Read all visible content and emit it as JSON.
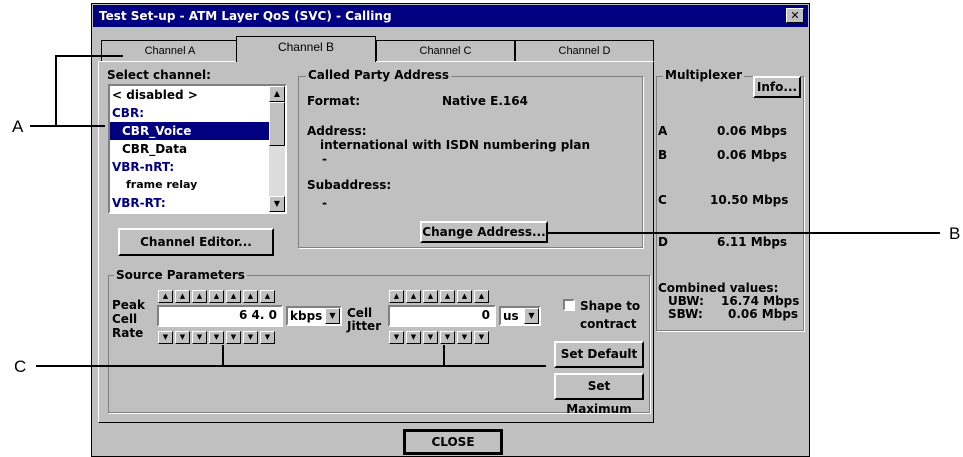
{
  "window": {
    "title": "Test Set-up - ATM Layer QoS (SVC) - Calling",
    "close_glyph": "✕"
  },
  "tabs": [
    {
      "label": "Channel A"
    },
    {
      "label": "Channel B"
    },
    {
      "label": "Channel C"
    },
    {
      "label": "Channel D"
    }
  ],
  "select_channel": {
    "label": "Select channel:",
    "items": [
      {
        "text": "< disabled >",
        "kind": "item"
      },
      {
        "text": "CBR:",
        "kind": "group"
      },
      {
        "text": "CBR_Voice",
        "kind": "selected"
      },
      {
        "text": "CBR_Data",
        "kind": "item"
      },
      {
        "text": "VBR-nRT:",
        "kind": "group"
      },
      {
        "text": "frame relay",
        "kind": "item"
      },
      {
        "text": "VBR-RT:",
        "kind": "group"
      }
    ]
  },
  "channel_editor": {
    "label": "Channel Editor..."
  },
  "called_party": {
    "legend": "Called Party Address",
    "format_label": "Format:",
    "format_value": "Native E.164",
    "address_label": "Address:",
    "address_value": "international with ISDN numbering plan",
    "address_extra": "-",
    "subaddress_label": "Subaddress:",
    "subaddress_value": "-",
    "change_button": "Change Address..."
  },
  "source_params": {
    "legend": "Source Parameters",
    "peak_label_1": "Peak",
    "peak_label_2": "Cell",
    "peak_label_3": "Rate",
    "peak_value": "6 4. 0",
    "peak_unit": "kbps",
    "jitter_label_1": "Cell",
    "jitter_label_2": "Jitter",
    "jitter_value": "0",
    "jitter_unit": "us",
    "shape_label_1": "Shape to",
    "shape_label_2": "contract",
    "set_default": "Set Default",
    "set_maximum": "Set Maximum"
  },
  "multiplexer": {
    "legend": "Multiplexer",
    "info_button": "Info...",
    "rows": [
      {
        "ch": "A",
        "value": "0.06 Mbps"
      },
      {
        "ch": "B",
        "value": "0.06 Mbps"
      },
      {
        "ch": "C",
        "value": "10.50 Mbps"
      },
      {
        "ch": "D",
        "value": "6.11 Mbps"
      }
    ],
    "combined_label": "Combined values:",
    "ubw_label": "UBW:",
    "ubw_value": "16.74 Mbps",
    "sbw_label": "SBW:",
    "sbw_value": "0.06 Mbps"
  },
  "close_button": "CLOSE",
  "callouts": {
    "a": "A",
    "b": "B",
    "c": "C"
  },
  "icons": {
    "spin_up": "▲",
    "spin_down": "▼",
    "scroll_up": "▲",
    "scroll_down": "▼",
    "dropdown": "▼"
  }
}
